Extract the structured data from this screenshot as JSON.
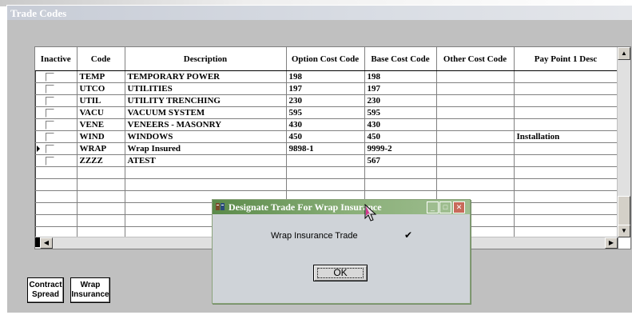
{
  "window": {
    "title": "Trade Codes"
  },
  "grid": {
    "columns": [
      "Inactive",
      "Code",
      "Description",
      "Option Cost Code",
      "Base Cost Code",
      "Other Cost Code",
      "Pay Point 1 Desc"
    ],
    "rows": [
      {
        "inactive": false,
        "code": "TEMP",
        "description": "TEMPORARY POWER",
        "option": "198",
        "base": "198",
        "other": "",
        "pay1": ""
      },
      {
        "inactive": false,
        "code": "UTCO",
        "description": "UTILITIES",
        "option": "197",
        "base": "197",
        "other": "",
        "pay1": ""
      },
      {
        "inactive": false,
        "code": "UTIL",
        "description": "UTILITY TRENCHING",
        "option": "230",
        "base": "230",
        "other": "",
        "pay1": ""
      },
      {
        "inactive": false,
        "code": "VACU",
        "description": "VACUUM SYSTEM",
        "option": "595",
        "base": "595",
        "other": "",
        "pay1": ""
      },
      {
        "inactive": false,
        "code": "VENE",
        "description": "VENEERS - MASONRY",
        "option": "430",
        "base": "430",
        "other": "",
        "pay1": ""
      },
      {
        "inactive": false,
        "code": "WIND",
        "description": "WINDOWS",
        "option": "450",
        "base": "450",
        "other": "",
        "pay1": "Installation"
      },
      {
        "inactive": false,
        "code": "WRAP",
        "description": "Wrap Insured",
        "option": "9898-1",
        "base": "9999-2",
        "other": "",
        "pay1": "",
        "current": true
      },
      {
        "inactive": false,
        "code": "ZZZZ",
        "description": "ATEST",
        "option": "",
        "base": "567",
        "other": "",
        "pay1": ""
      }
    ],
    "empty_rows": 8
  },
  "buttons": {
    "contract_spread": [
      "Contract",
      "Spread"
    ],
    "wrap_insurance": [
      "Wrap",
      "Insurance"
    ]
  },
  "dialog": {
    "title": "Designate Trade For Wrap Insurance",
    "label": "Wrap Insurance Trade",
    "checked": true,
    "ok_label": "OK"
  }
}
